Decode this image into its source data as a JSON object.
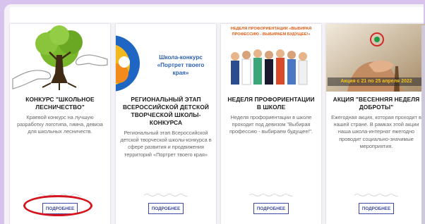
{
  "cards": [
    {
      "title": "КОНКУРС \"ШКОЛЬНОЕ ЛЕСНИЧЕСТВО\"",
      "description": "Краевой конкурс на лучшую разработку логотипа, гимна, девиза для школьных лесничеств.",
      "button": "ПОДРОБНЕЕ"
    },
    {
      "title": "РЕГИОНАЛЬНЫЙ ЭТАП ВСЕРОССИЙСКОЙ ДЕТСКОЙ ТВОРЧЕСКОЙ ШКОЛЫ-КОНКУРСА",
      "description": "Региональный этап Всероссийской детской творческой школы-конкурса в сфере развития и продвижения территорий «Портрет твоего края»",
      "button": "ПОДРОБНЕЕ",
      "image_text": "Школа-конкурс «Портрет твоего края»"
    },
    {
      "title": "НЕДЕЛЯ ПРОФОРИЕНТАЦИИ В ШКОЛЕ",
      "description": "Неделя профориентации в школе проходит под девизом \"Выбирая профессию - выбираем будущее!\".",
      "button": "ПОДРОБНЕЕ",
      "image_text": "НЕДЕЛЯ ПРОФОРИЕНТАЦИИ «ВЫБИРАЯ ПРОФЕССИЮ - ВЫБИРАЕМ БУДУЩЕЕ!»"
    },
    {
      "title": "АКЦИЯ \"ВЕСЕННЯЯ НЕДЕЛЯ ДОБРОТЫ\"",
      "description": "Ежегодная акция, которая проходит в нашей стране. В рамках этой акции наша школа-интернат ежегодно проводит социально-значимые мероприятия.",
      "button": "ПОДРОБНЕЕ",
      "image_text": "Акция с 21 по 25 апреля 2022"
    }
  ],
  "colors": {
    "accent": "#3d4aa3",
    "highlight": "#d3151f",
    "page": "#d8c2ee"
  }
}
